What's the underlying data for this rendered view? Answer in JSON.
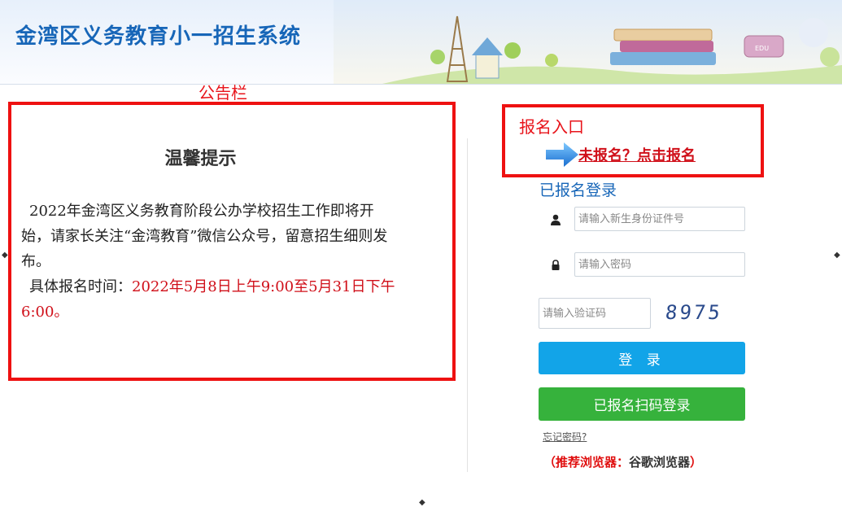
{
  "header": {
    "title": "金湾区义务教育小一招生系统"
  },
  "notice": {
    "label": "公告栏",
    "title": "温馨提示",
    "paragraph1": "2022年金湾区义务教育阶段公办学校招生工作即将开始，请家长关注“金湾教育”微信公众号，留意招生细则发布。",
    "time_label": "具体报名时间：",
    "time_value": "2022年5月8日上午9:00至5月31日下午6:00。"
  },
  "register": {
    "label": "报名入口",
    "link": "未报名？点击报名"
  },
  "login": {
    "heading": "已报名登录",
    "id_placeholder": "请输入新生身份证件号",
    "password_placeholder": "请输入密码",
    "captcha_placeholder": "请输入验证码",
    "captcha_text": "8975",
    "login_button": "登 录",
    "scan_button": "已报名扫码登录",
    "forgot": "忘记密码?",
    "browser_tip_open": "（推荐浏览器：",
    "browser_tip_name": "谷歌浏览器",
    "browser_tip_close": "）"
  },
  "colors": {
    "accent_blue": "#1766b8",
    "alert_red": "#ee1111",
    "login_blue": "#12a4e8",
    "scan_green": "#36b23c"
  },
  "icons": [
    "user-icon",
    "lock-icon",
    "arrow-right-icon"
  ]
}
